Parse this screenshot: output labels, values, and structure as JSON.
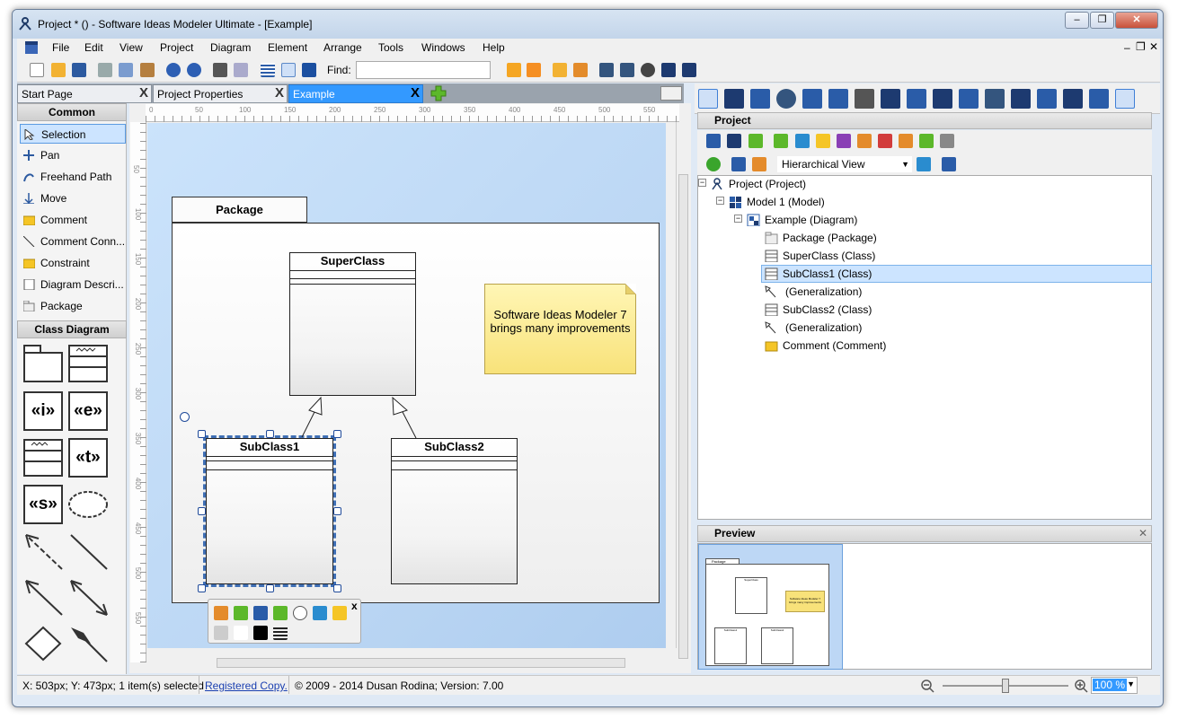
{
  "window": {
    "title": "Project * () - Software Ideas Modeler Ultimate - [Example]",
    "min": "–",
    "restore": "❐",
    "close": "✕"
  },
  "menu": [
    "File",
    "Edit",
    "View",
    "Project",
    "Diagram",
    "Element",
    "Arrange",
    "Tools",
    "Windows",
    "Help"
  ],
  "toolbar": {
    "find_label": "Find:",
    "find_value": ""
  },
  "tabs": [
    {
      "label": "Start Page",
      "close": "X"
    },
    {
      "label": "Project Properties",
      "close": "X"
    },
    {
      "label": "Example",
      "close": "X"
    }
  ],
  "toolbox": {
    "common_header": "Common",
    "common_items": [
      "Selection",
      "Pan",
      "Freehand Path",
      "Move",
      "Comment",
      "Comment Conn...",
      "Constraint",
      "Diagram Descri...",
      "Package"
    ],
    "class_header": "Class Diagram",
    "stereotypes": [
      "«i»",
      "«e»",
      "«t»",
      "«s»"
    ]
  },
  "ruler": {
    "h": [
      "0",
      "50",
      "100",
      "150",
      "200",
      "250",
      "300",
      "350",
      "400",
      "450",
      "500",
      "550"
    ],
    "v": [
      "50",
      "100",
      "150",
      "200",
      "250",
      "300",
      "350",
      "400",
      "450",
      "500",
      "550"
    ]
  },
  "diagram": {
    "package": "Package",
    "superclass": "SuperClass",
    "subclass1": "SubClass1",
    "subclass2": "SubClass2",
    "note": "Software Ideas Modeler 7 brings many improvements",
    "floatbar_close": "x"
  },
  "project_panel": {
    "title": "Project",
    "view_select": "Hierarchical View",
    "tree": [
      "Project (Project)",
      "Model 1 (Model)",
      "Example (Diagram)",
      "Package (Package)",
      "SuperClass (Class)",
      "SubClass1 (Class)",
      "(Generalization)",
      "SubClass2 (Class)",
      "(Generalization)",
      "Comment (Comment)"
    ],
    "expand": "−"
  },
  "preview_panel": {
    "title": "Preview",
    "close": "✕",
    "package": "Package",
    "superclass": "SuperClass",
    "subclass1": "SubClass1",
    "subclass2": "SubClass2",
    "note": "Software Ideas Modeler 7 brings many improvements"
  },
  "status": {
    "coords": "X: 503px; Y: 473px; 1 item(s) selected",
    "registered": "Registered Copy.",
    "copyright": "© 2009 - 2014 Dusan Rodina; Version: 7.00",
    "zoom": "100 %",
    "zoom_level": 0.5
  },
  "colors": {
    "accent": "#3399ff",
    "diagram_bg": "#c2daf6",
    "note": "#f8e27a",
    "selection": "#cce4ff"
  }
}
